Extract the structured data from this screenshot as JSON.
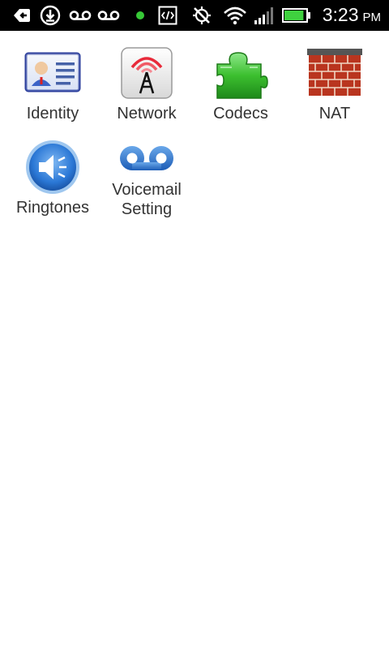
{
  "status_bar": {
    "time": "3:23",
    "ampm": "PM",
    "icons": [
      "back-notification-icon",
      "download-icon",
      "voicemail-icon",
      "voicemail-icon",
      "green-dot-icon",
      "developer-code-icon",
      "gps-off-icon",
      "wifi-icon",
      "signal-icon",
      "battery-icon"
    ],
    "battery_level": 0.9,
    "battery_color": "#3fd13f"
  },
  "apps": [
    {
      "label": "Identity",
      "icon": "identity-card-icon"
    },
    {
      "label": "Network",
      "icon": "network-tower-icon"
    },
    {
      "label": "Codecs",
      "icon": "puzzle-piece-icon"
    },
    {
      "label": "NAT",
      "icon": "brick-wall-icon"
    },
    {
      "label": "Ringtones",
      "icon": "speaker-icon"
    },
    {
      "label": "Voicemail Setting",
      "icon": "voicemail-tape-icon"
    }
  ]
}
